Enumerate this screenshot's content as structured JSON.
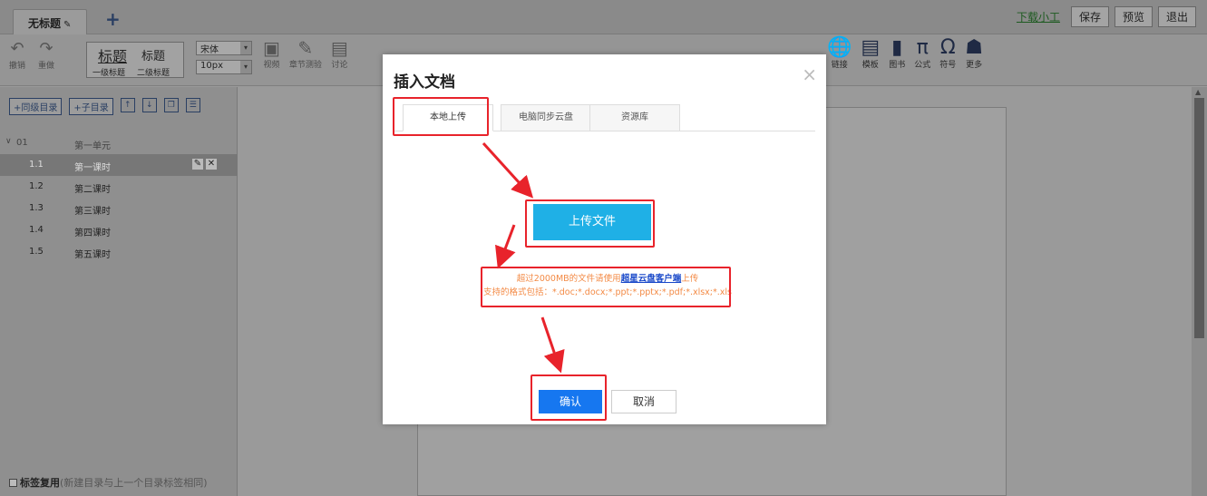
{
  "tabbar": {
    "doc_tab": "无标题",
    "add_tab": "+",
    "download_tool": "下载小工",
    "save": "保存",
    "preview": "预览",
    "exit": "退出"
  },
  "toolbar": {
    "undo": "撤销",
    "redo": "重做",
    "heading1": "标题",
    "heading2": "标题",
    "heading1_sub": "一级标题",
    "heading2_sub": "二级标题",
    "font_family": "宋体",
    "font_size": "10px",
    "video": "视频",
    "chapter_quiz": "章节测验",
    "discussion": "讨论",
    "right_tools": [
      {
        "label": "链接",
        "icon": "globe-icon",
        "glyph": "🌐"
      },
      {
        "label": "模板",
        "icon": "template-icon",
        "glyph": "▤"
      },
      {
        "label": "图书",
        "icon": "book-icon",
        "glyph": "▮"
      },
      {
        "label": "公式",
        "icon": "pi-icon",
        "glyph": "π"
      },
      {
        "label": "符号",
        "icon": "omega-icon",
        "glyph": "Ω"
      },
      {
        "label": "更多",
        "icon": "more-icon",
        "glyph": "☗"
      }
    ]
  },
  "sidebar": {
    "add_sibling": "+同级目录",
    "add_child": "+子目录",
    "unit": {
      "num": "01",
      "title": "第一单元"
    },
    "lessons": [
      {
        "num": "1.1",
        "title": "第一课时"
      },
      {
        "num": "1.2",
        "title": "第二课时"
      },
      {
        "num": "1.3",
        "title": "第三课时"
      },
      {
        "num": "1.4",
        "title": "第四课时"
      },
      {
        "num": "1.5",
        "title": "第五课时"
      }
    ],
    "tag_reuse_label": "标签复用",
    "tag_reuse_note": "(新建目录与上一个目录标签相同)"
  },
  "dialog": {
    "title": "插入文档",
    "close": "×",
    "tabs": [
      "本地上传",
      "电脑同步云盘",
      "资源库"
    ],
    "upload_button": "上传文件",
    "note_prefix": "超过2000MB的文件请使用",
    "note_link": "超星云盘客户端",
    "note_suffix": "上传",
    "note_formats": "支持的格式包括：*.doc;*.docx;*.ppt;*.pptx;*.pdf;*.xlsx;*.xls",
    "confirm": "确认",
    "cancel": "取消"
  },
  "colors": {
    "highlight": "#e8232b",
    "upload_button": "#1fb0e6",
    "confirm_button": "#1677f0",
    "note_text": "#f38a45",
    "link": "#1848c9"
  }
}
